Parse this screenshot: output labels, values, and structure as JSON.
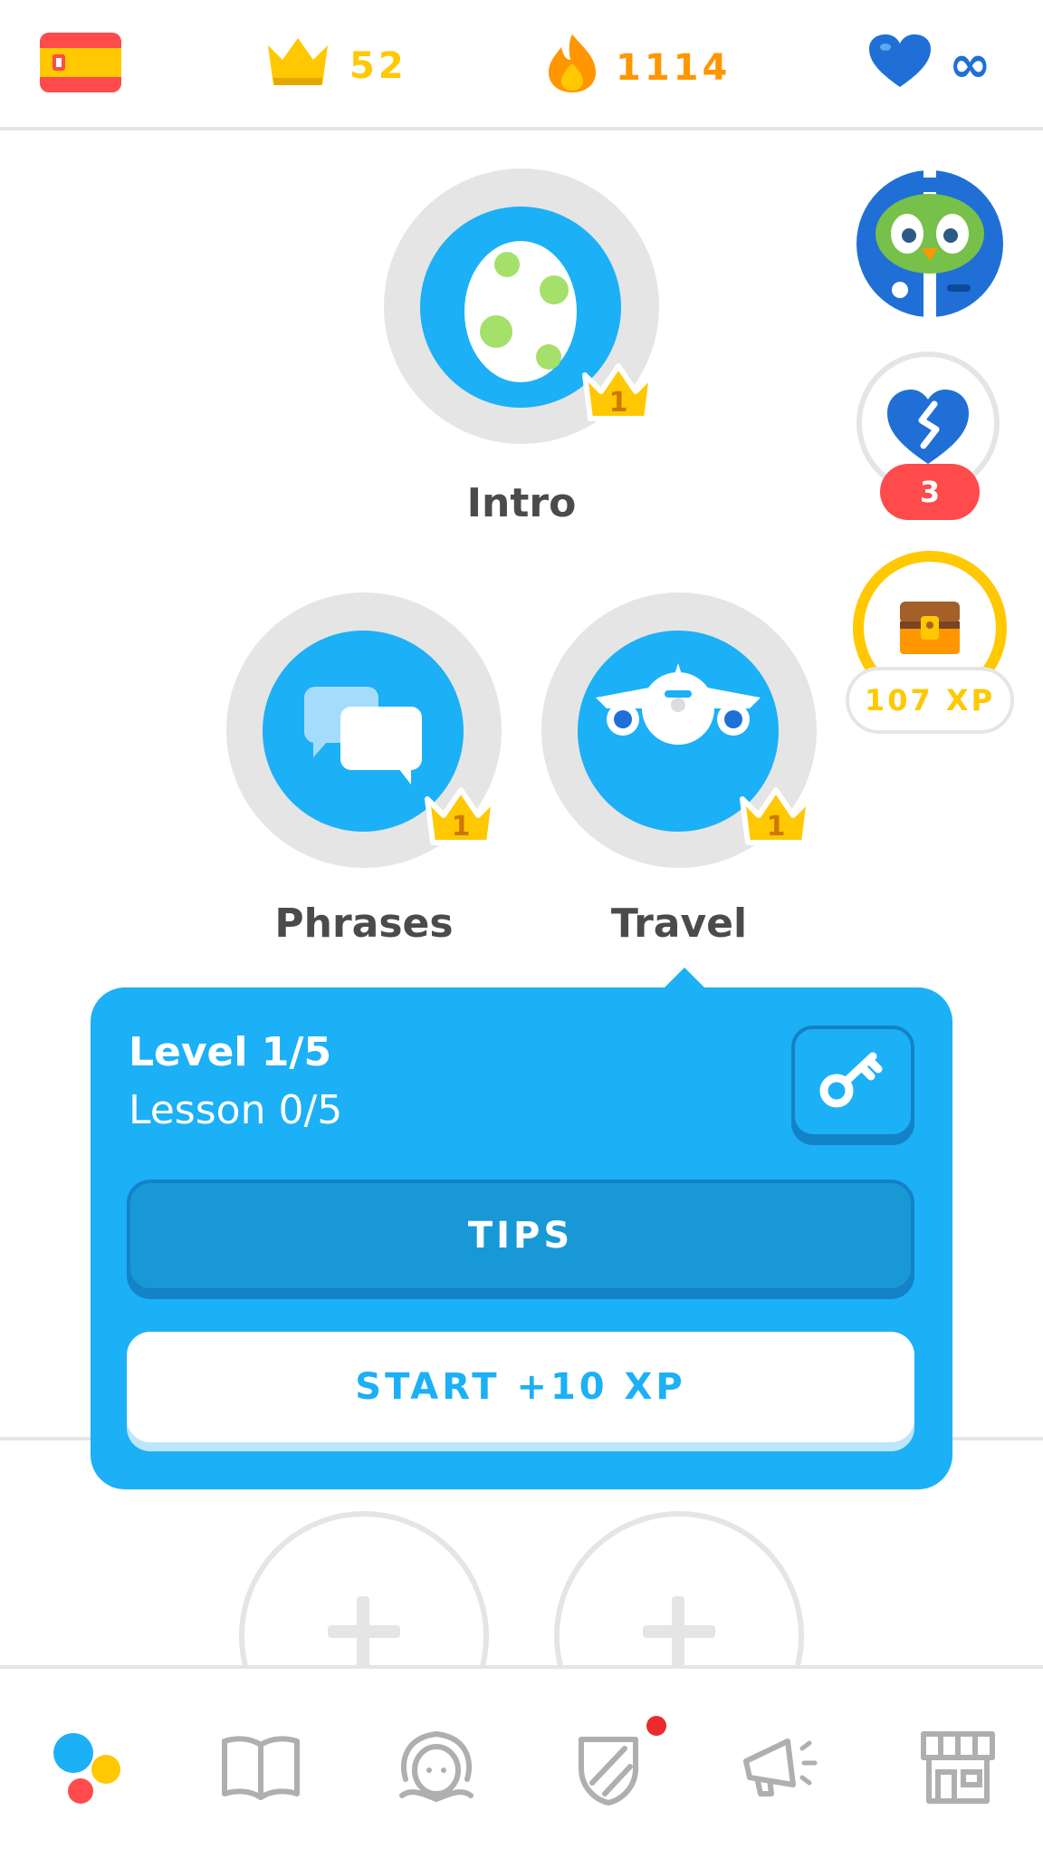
{
  "topbar": {
    "crowns": "52",
    "streak": "1114",
    "hearts": "∞",
    "colors": {
      "crown": "#ffc800",
      "streak": "#ff9600",
      "heart": "#1f6fd6"
    }
  },
  "skills": {
    "intro": {
      "label": "Intro",
      "level": "1"
    },
    "phrases": {
      "label": "Phrases",
      "level": "1"
    },
    "travel": {
      "label": "Travel",
      "level": "1"
    }
  },
  "side": {
    "health_count": "3",
    "chest_xp": "107 XP"
  },
  "popup": {
    "level": "Level 1/5",
    "lesson": "Lesson 0/5",
    "tips_label": "TIPS",
    "start_label": "START +10 XP"
  },
  "nav": {
    "items": [
      "learn-icon",
      "stories-icon",
      "profile-icon",
      "leagues-icon",
      "news-icon",
      "shop-icon"
    ]
  }
}
